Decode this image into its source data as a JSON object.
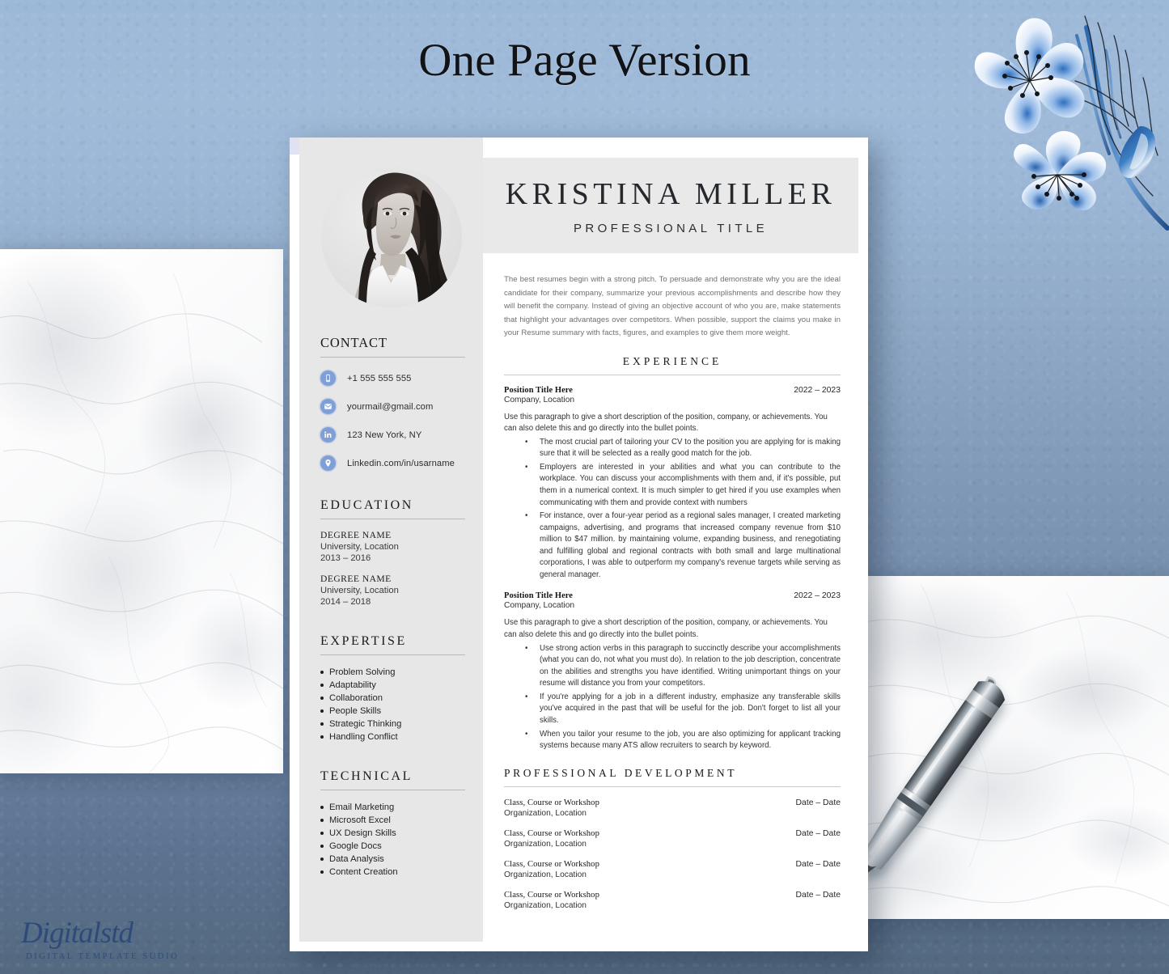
{
  "page": {
    "heading": "One Page Version",
    "background_color": "#8faccd",
    "accent_blue": "#7f9fd6",
    "lavender": "#dfe2f2",
    "sidebar_gray": "#e7e7e7",
    "header_gray": "#e9e9e9"
  },
  "watermark": {
    "brand": "Digitalstd",
    "tagline": "DIGITAL TEMPLATE SUDIO"
  },
  "decor": {
    "flowers": "blue-flowers-illustration",
    "pen": "silver-fountain-pen",
    "marble_left": "white-marble-block",
    "marble_right": "white-marble-block"
  },
  "resume": {
    "header": {
      "photo": "portrait-photo",
      "name": "KRISTINA MILLER",
      "title": "PROFESSIONAL TITLE"
    },
    "sidebar": {
      "contact": {
        "heading": "CONTACT",
        "items": [
          {
            "icon": "phone-icon",
            "text": "+1 555 555 555"
          },
          {
            "icon": "envelope-icon",
            "text": "yourmail@gmail.com"
          },
          {
            "icon": "linkedin-icon",
            "text": "123 New York, NY"
          },
          {
            "icon": "location-pin-icon",
            "text": "Linkedin.com/in/usarname"
          }
        ]
      },
      "education": {
        "heading": "EDUCATION",
        "items": [
          {
            "degree": "DEGREE NAME",
            "school": "University, Location",
            "years": "2013 – 2016"
          },
          {
            "degree": "DEGREE NAME",
            "school": "University, Location",
            "years": "2014 – 2018"
          }
        ]
      },
      "expertise": {
        "heading": "EXPERTISE",
        "items": [
          "Problem Solving",
          "Adaptability",
          "Collaboration",
          "People Skills",
          "Strategic Thinking",
          "Handling Conflict"
        ]
      },
      "technical": {
        "heading": "TECHNICAL",
        "items": [
          "Email Marketing",
          "Microsoft Excel",
          "UX Design Skills",
          "Google Docs",
          "Data Analysis",
          "Content Creation"
        ]
      }
    },
    "main": {
      "summary": "The best resumes begin with a strong pitch. To persuade and demonstrate why you are the ideal candidate for their company, summarize your previous accomplishments and describe how they will benefit the company. Instead of giving an objective account of who you are, make statements that highlight your advantages over competitors. When possible, support the claims you make in your Resume summary with facts, figures, and examples to give them more weight.",
      "experience": {
        "heading": "EXPERIENCE",
        "jobs": [
          {
            "title": "Position Title Here",
            "date": "2022 – 2023",
            "company": "Company, Location",
            "description": "Use this paragraph to give a short description of the position, company, or achievements. You can also delete this and go directly into the bullet points.",
            "bullets": [
              "The most crucial part of tailoring your CV to the position you are applying for is making sure that it will be selected as a really good match for the job.",
              "Employers are interested in your abilities and what you can contribute to the workplace. You can discuss your accomplishments with them and, if it's possible, put them in a numerical context. It is much simpler to get hired if you use examples when communicating with them and provide context with numbers",
              "For instance, over a four-year period as a regional sales manager, I created marketing campaigns, advertising, and programs that increased company revenue from $10 million to $47 million. by maintaining volume, expanding business, and renegotiating and fulfilling global and regional contracts with both small and large multinational corporations, I was able to outperform my company's revenue targets while serving as general manager."
            ]
          },
          {
            "title": "Position Title Here",
            "date": "2022 – 2023",
            "company": "Company, Location",
            "description": "Use this paragraph to give a short description of the position, company, or achievements. You can also delete this and go directly into the bullet points.",
            "bullets": [
              "Use strong action verbs in this paragraph to succinctly describe your accomplishments (what you can do, not what you must do). In relation to the job description, concentrate on the abilities and strengths you have identified. Writing unimportant things on your resume will distance you from your competitors.",
              "If you're applying for a job in a different industry, emphasize any transferable skills you've acquired in the past that will be useful for the job. Don't forget to list all your skills.",
              "When you tailor your resume to the job, you are also optimizing for applicant tracking systems because many ATS allow recruiters to search by keyword."
            ]
          }
        ]
      },
      "professional_development": {
        "heading": "PROFESSIONAL DEVELOPMENT",
        "items": [
          {
            "title": "Class, Course or Workshop",
            "org": "Organization, Location",
            "date": "Date – Date"
          },
          {
            "title": "Class, Course or Workshop",
            "org": "Organization, Location",
            "date": "Date – Date"
          },
          {
            "title": "Class, Course or Workshop",
            "org": "Organization, Location",
            "date": "Date – Date"
          },
          {
            "title": "Class, Course or Workshop",
            "org": "Organization, Location",
            "date": "Date – Date"
          }
        ]
      }
    }
  }
}
